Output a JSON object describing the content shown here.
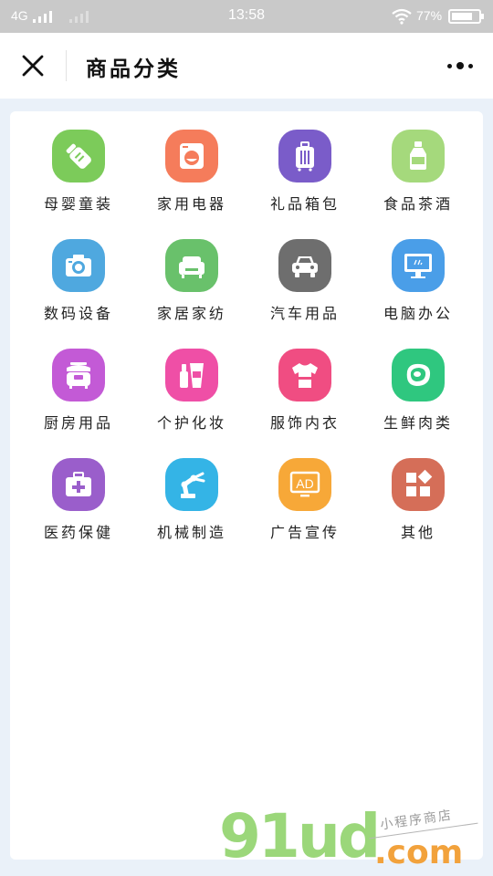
{
  "status_bar": {
    "network": "4G",
    "time": "13:58",
    "battery": "77%",
    "battery_level": 0.77
  },
  "navbar": {
    "title": "商品分类",
    "close_icon": "close-icon",
    "more_icon": "more-dots-icon"
  },
  "categories": [
    {
      "label": "母婴童装",
      "icon": "baby-bottle-icon",
      "color": "#7ccb5a"
    },
    {
      "label": "家用电器",
      "icon": "washing-machine-icon",
      "color": "#f57c5b"
    },
    {
      "label": "礼品箱包",
      "icon": "luggage-icon",
      "color": "#7a5cc9"
    },
    {
      "label": "食品茶酒",
      "icon": "bottle-icon",
      "color": "#a5d97c"
    },
    {
      "label": "数码设备",
      "icon": "camera-icon",
      "color": "#4fa8df"
    },
    {
      "label": "家居家纺",
      "icon": "sofa-icon",
      "color": "#69c16b"
    },
    {
      "label": "汽车用品",
      "icon": "car-icon",
      "color": "#6e6e6e"
    },
    {
      "label": "电脑办公",
      "icon": "monitor-icon",
      "color": "#4a9ee8"
    },
    {
      "label": "厨房用品",
      "icon": "rice-cooker-icon",
      "color": "#c35ad6"
    },
    {
      "label": "个护化妆",
      "icon": "cosmetics-icon",
      "color": "#ef4fa6"
    },
    {
      "label": "服饰内衣",
      "icon": "tshirt-icon",
      "color": "#f04d82"
    },
    {
      "label": "生鲜肉类",
      "icon": "meat-icon",
      "color": "#2fc77f"
    },
    {
      "label": "医药保健",
      "icon": "medical-kit-icon",
      "color": "#9a5ecb"
    },
    {
      "label": "机械制造",
      "icon": "robot-arm-icon",
      "color": "#34b4e6"
    },
    {
      "label": "广告宣传",
      "icon": "ad-icon",
      "color": "#f7a838"
    },
    {
      "label": "其他",
      "icon": "grid-icon",
      "color": "#d56e58"
    }
  ],
  "watermark": {
    "brand": "91ud",
    "domain": ".com",
    "tagline": "小程序商店"
  }
}
